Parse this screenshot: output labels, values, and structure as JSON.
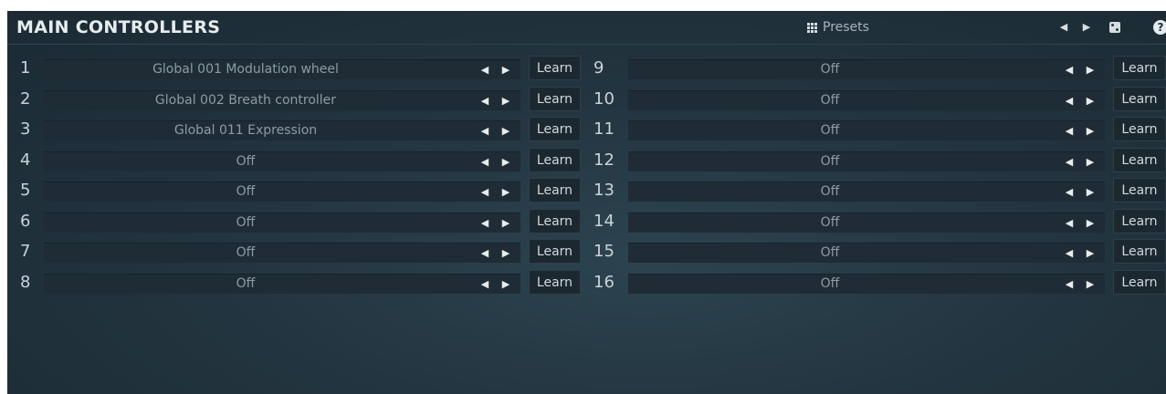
{
  "header": {
    "title": "MAIN CONTROLLERS",
    "presets_label": "Presets",
    "help_label": "?"
  },
  "left_controllers": [
    {
      "number": "1",
      "value": "Global 001 Modulation wheel",
      "learn": "Learn"
    },
    {
      "number": "2",
      "value": "Global 002 Breath controller",
      "learn": "Learn"
    },
    {
      "number": "3",
      "value": "Global 011 Expression",
      "learn": "Learn"
    },
    {
      "number": "4",
      "value": "Off",
      "learn": "Learn"
    },
    {
      "number": "5",
      "value": "Off",
      "learn": "Learn"
    },
    {
      "number": "6",
      "value": "Off",
      "learn": "Learn"
    },
    {
      "number": "7",
      "value": "Off",
      "learn": "Learn"
    },
    {
      "number": "8",
      "value": "Off",
      "learn": "Learn"
    }
  ],
  "right_controllers": [
    {
      "number": "9",
      "value": "Off",
      "learn": "Learn"
    },
    {
      "number": "10",
      "value": "Off",
      "learn": "Learn"
    },
    {
      "number": "11",
      "value": "Off",
      "learn": "Learn"
    },
    {
      "number": "12",
      "value": "Off",
      "learn": "Learn"
    },
    {
      "number": "13",
      "value": "Off",
      "learn": "Learn"
    },
    {
      "number": "14",
      "value": "Off",
      "learn": "Learn"
    },
    {
      "number": "15",
      "value": "Off",
      "learn": "Learn"
    },
    {
      "number": "16",
      "value": "Off",
      "learn": "Learn"
    }
  ],
  "icons": {
    "prev": "triangle-left-icon",
    "next": "triangle-right-icon",
    "grid": "grid-icon",
    "random": "dice-icon",
    "help": "help-icon"
  }
}
